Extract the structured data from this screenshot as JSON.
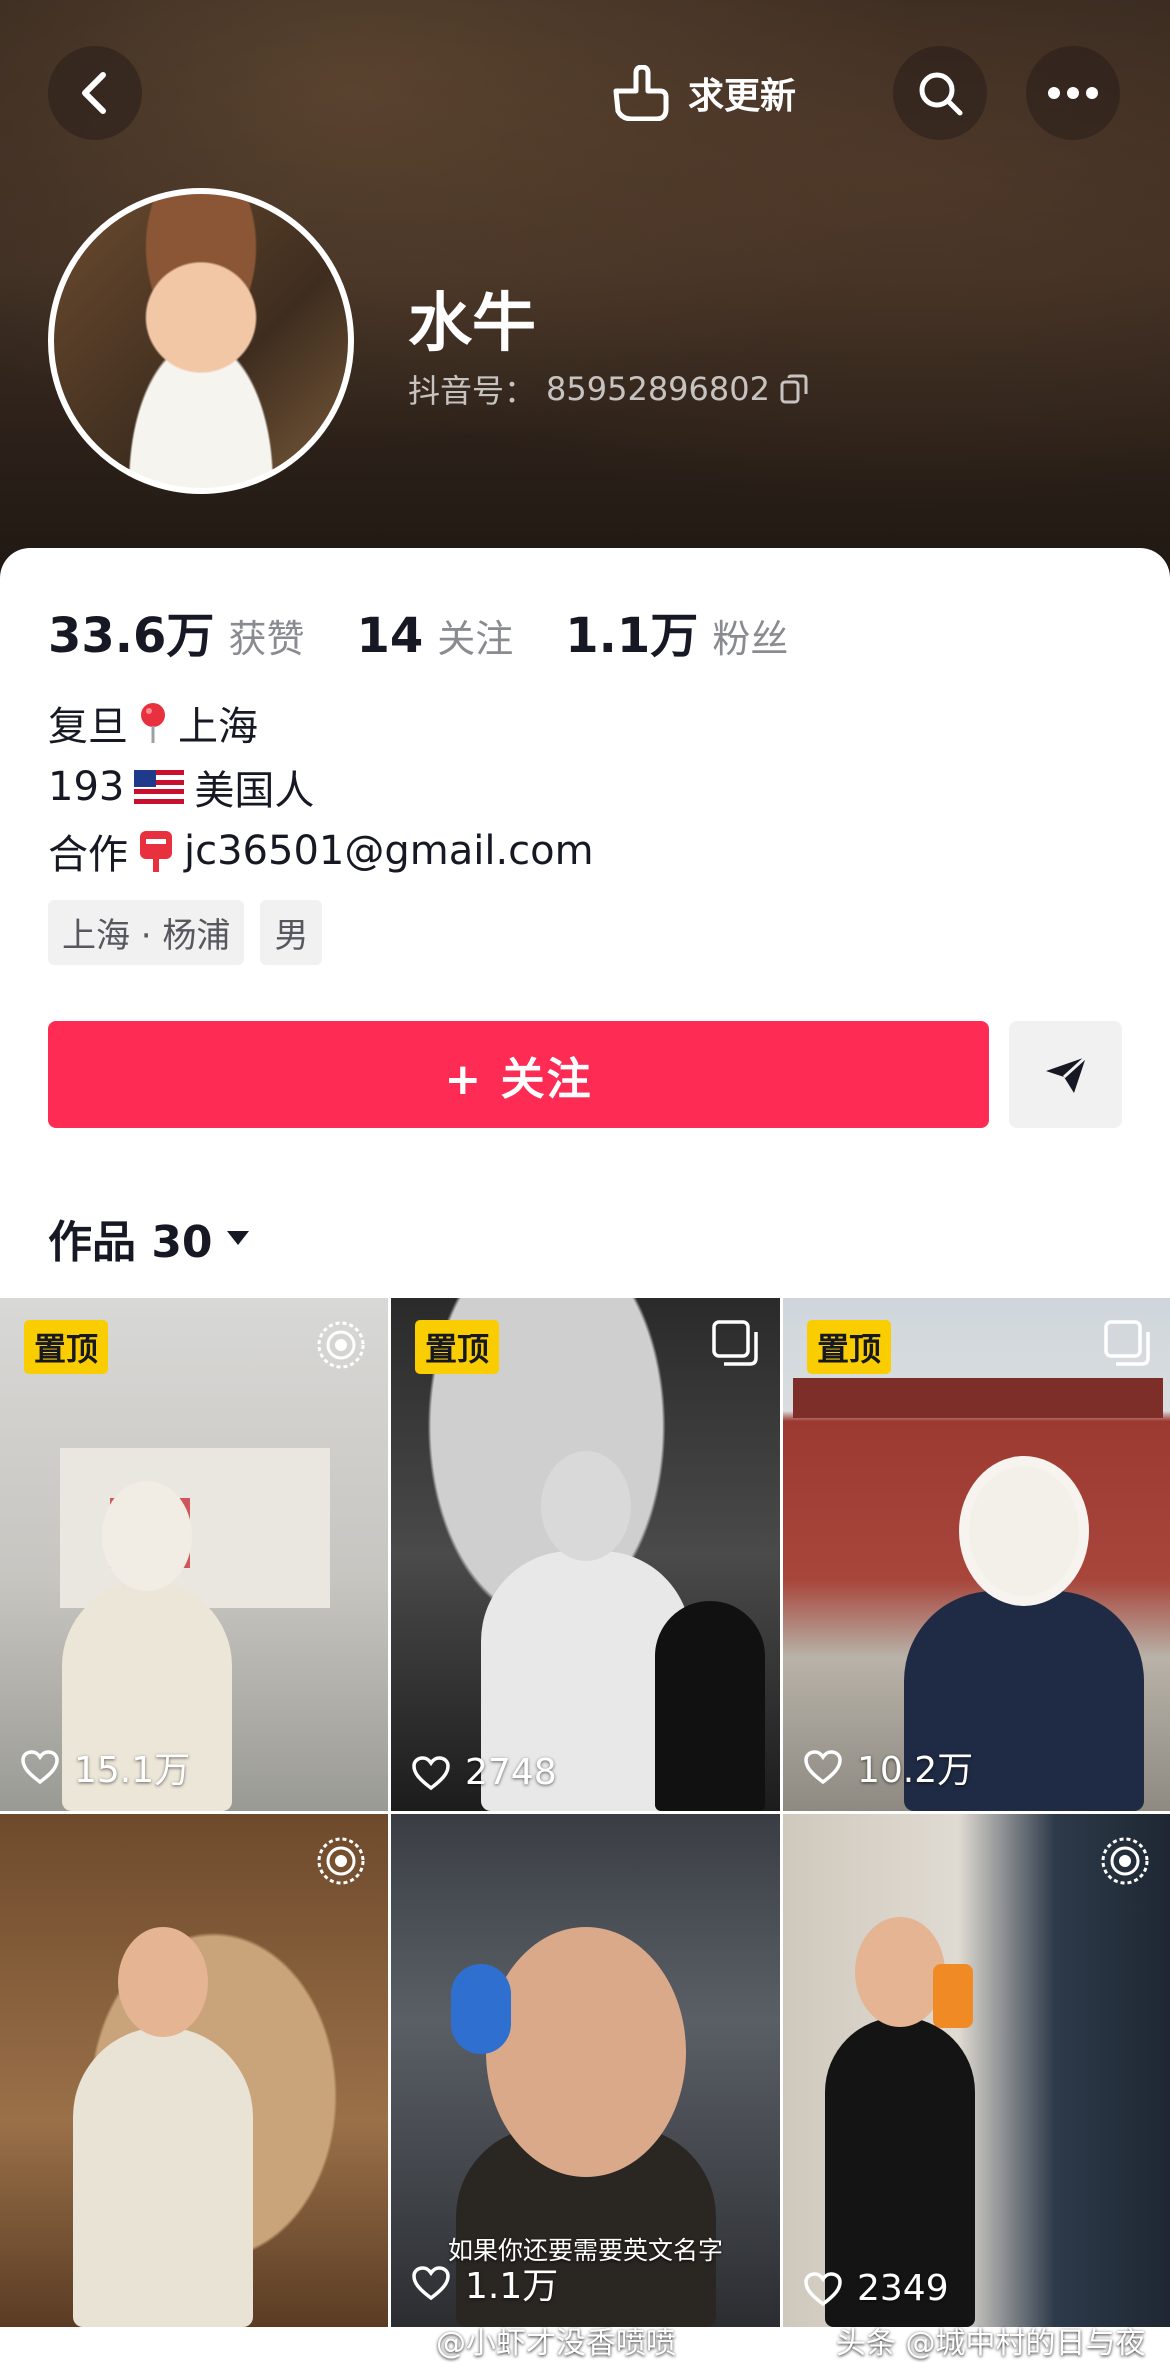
{
  "header": {
    "update_label": "求更新",
    "username": "水牛",
    "douyin_id_label": "抖音号：",
    "douyin_id": "85952896802"
  },
  "stats": [
    {
      "value": "33.6万",
      "label": "获赞"
    },
    {
      "value": "14",
      "label": "关注"
    },
    {
      "value": "1.1万",
      "label": "粉丝"
    }
  ],
  "bio": {
    "line1_a": "复旦",
    "line1_b": "上海",
    "line2_a": "193",
    "line2_b": "美国人",
    "line3_a": "合作",
    "line3_b": "jc36501@gmail.com"
  },
  "tags": [
    "上海 · 杨浦",
    "男"
  ],
  "actions": {
    "follow_label": "+ 关注"
  },
  "works": {
    "tab_label": "作品 30",
    "items": [
      {
        "pinned": "置顶",
        "likes": "15.1万",
        "corner": "live-icon"
      },
      {
        "pinned": "置顶",
        "likes": "2748",
        "corner": "gallery-icon"
      },
      {
        "pinned": "置顶",
        "likes": "10.2万",
        "corner": "gallery-icon"
      },
      {
        "pinned": "",
        "likes": "",
        "corner": "live-icon"
      },
      {
        "pinned": "",
        "likes": "1.1万",
        "corner": "",
        "subtitle": "如果你还要需要英文名字"
      },
      {
        "pinned": "",
        "likes": "2349",
        "corner": "live-icon"
      }
    ]
  },
  "watermarks": {
    "left": "@小虾才没香喷喷",
    "right": "头条 @城中村的日与夜"
  },
  "colors": {
    "accent": "#fe2c55",
    "pin": "#facd00"
  }
}
